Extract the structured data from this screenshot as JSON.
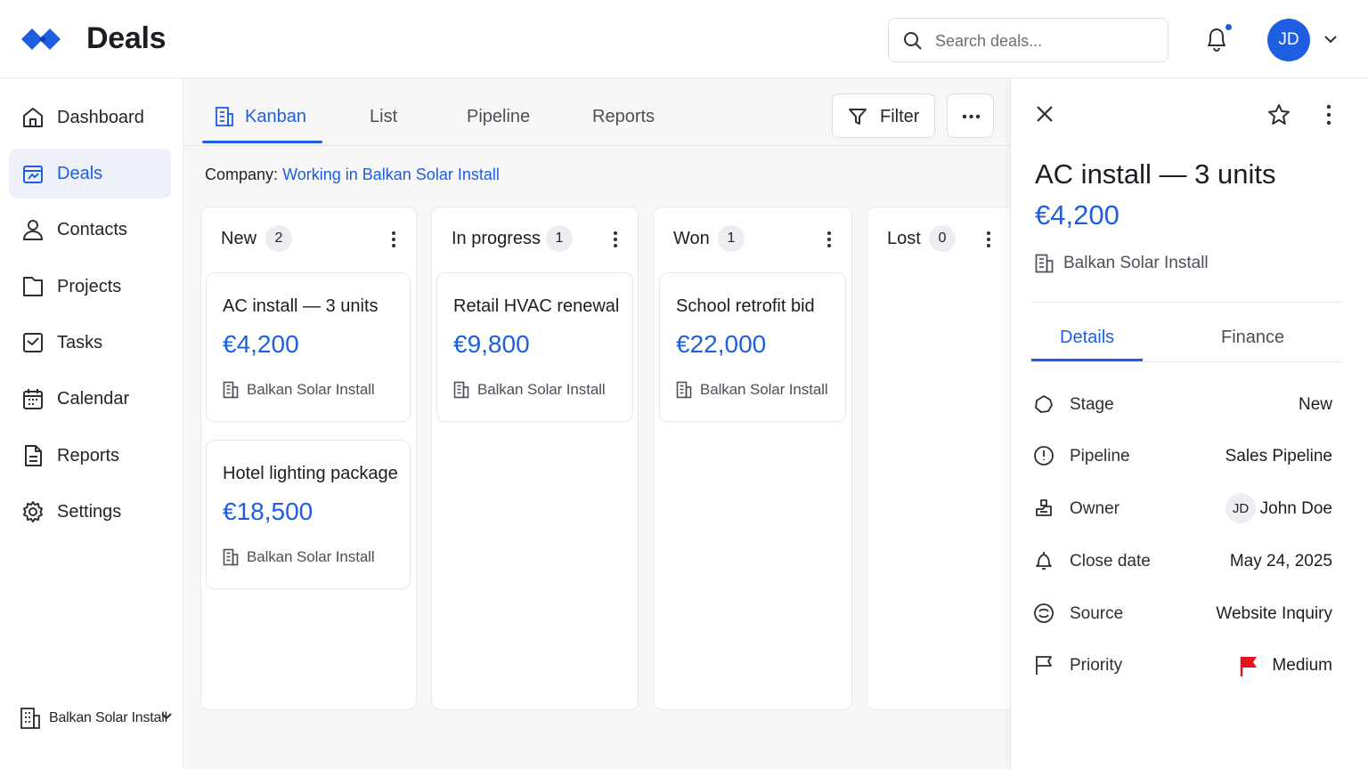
{
  "app": {
    "title": "Deals"
  },
  "search": {
    "placeholder": "Search deals..."
  },
  "user": {
    "initials": "JD"
  },
  "colors": {
    "accent": "#1d5fe0",
    "priority_flag": "#e0151a"
  },
  "sidebar": {
    "items": [
      {
        "label": "Dashboard",
        "icon": "home-icon"
      },
      {
        "label": "Deals",
        "icon": "deals-icon",
        "active": true
      },
      {
        "label": "Contacts",
        "icon": "user-icon"
      },
      {
        "label": "Projects",
        "icon": "folder-icon"
      },
      {
        "label": "Tasks",
        "icon": "checkbox-icon"
      },
      {
        "label": "Calendar",
        "icon": "calendar-icon"
      },
      {
        "label": "Reports",
        "icon": "document-icon"
      },
      {
        "label": "Settings",
        "icon": "gear-icon"
      }
    ],
    "org": {
      "label": "Balkan Solar Install"
    }
  },
  "tabs": [
    {
      "label": "Kanban",
      "active": true
    },
    {
      "label": "List"
    },
    {
      "label": "Pipeline"
    },
    {
      "label": "Reports"
    }
  ],
  "toolbar": {
    "filter_label": "Filter"
  },
  "company_filter": {
    "key": "Company:",
    "value": "Working in Balkan Solar Install"
  },
  "columns": [
    {
      "title": "New",
      "count": "2",
      "cards": [
        {
          "title": "AC install — 3 units",
          "amount": "€4,200",
          "org": "Balkan Solar Install"
        },
        {
          "title": "Hotel lighting package",
          "amount": "€18,500",
          "org": "Balkan Solar Install"
        }
      ]
    },
    {
      "title": "In progress",
      "count": "1",
      "cards": [
        {
          "title": "Retail HVAC renewal",
          "amount": "€9,800",
          "org": "Balkan Solar Install"
        }
      ]
    },
    {
      "title": "Won",
      "count": "1",
      "cards": [
        {
          "title": "School retrofit bid",
          "amount": "€22,000",
          "org": "Balkan Solar Install"
        }
      ]
    },
    {
      "title": "Lost",
      "count": "0",
      "cards": []
    }
  ],
  "panel": {
    "title": "AC install — 3 units",
    "amount": "€4,200",
    "org": "Balkan Solar Install",
    "tabs": [
      {
        "label": "Details",
        "active": true
      },
      {
        "label": "Finance"
      }
    ],
    "details": [
      {
        "label": "Stage",
        "value": "New",
        "icon": "stage-icon"
      },
      {
        "label": "Pipeline",
        "value": "Sales Pipeline",
        "icon": "pipeline-icon"
      },
      {
        "label": "Owner",
        "value": "John Doe",
        "avatar": "JD",
        "icon": "owner-icon"
      },
      {
        "label": "Close date",
        "value": "May 24, 2025",
        "icon": "close-date-icon"
      },
      {
        "label": "Source",
        "value": "Website Inquiry",
        "icon": "source-icon"
      },
      {
        "label": "Priority",
        "value": "Medium",
        "icon": "flag-outline-icon"
      }
    ]
  }
}
